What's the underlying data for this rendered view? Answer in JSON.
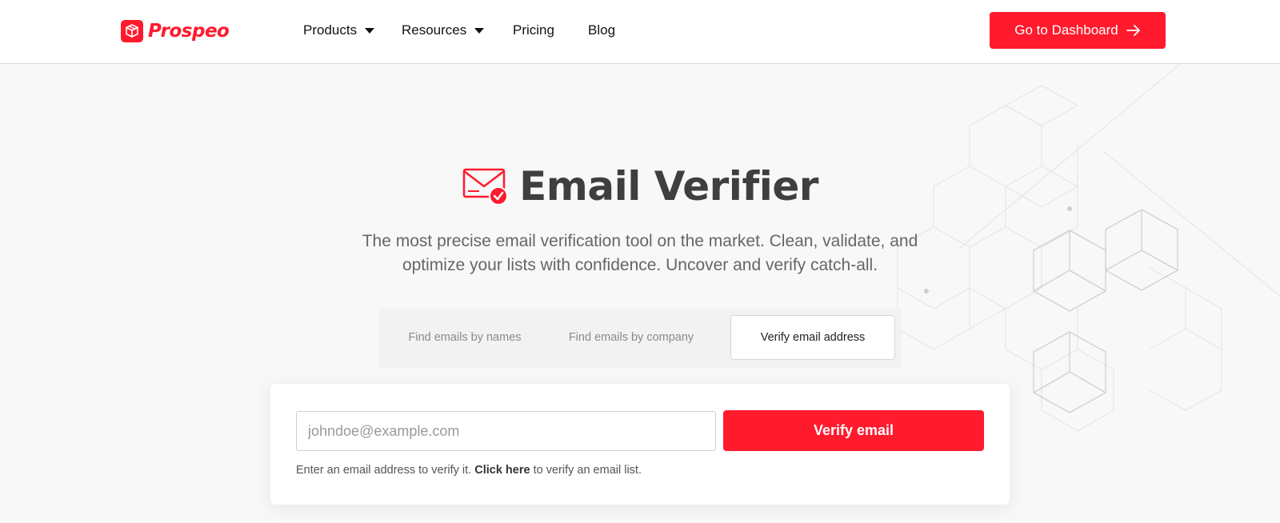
{
  "header": {
    "logo_text": "Prospeo",
    "logo_icon": "box-icon",
    "nav": [
      {
        "label": "Products",
        "has_dropdown": true
      },
      {
        "label": "Resources",
        "has_dropdown": true
      },
      {
        "label": "Pricing",
        "has_dropdown": false
      },
      {
        "label": "Blog",
        "has_dropdown": false
      }
    ],
    "cta_label": "Go to Dashboard",
    "cta_icon": "arrow-right-icon"
  },
  "hero": {
    "icon": "envelope-check-icon",
    "title": "Email Verifier",
    "subtitle_line1": "The most precise email verification tool on the market. Clean, validate, and",
    "subtitle_line2": "optimize your lists with confidence. Uncover and verify catch-all."
  },
  "tabs": [
    {
      "label": "Find emails by names",
      "active": false
    },
    {
      "label": "Find emails by company",
      "active": false
    },
    {
      "label": "Verify email address",
      "active": true
    }
  ],
  "form": {
    "email_placeholder": "johndoe@example.com",
    "email_value": "",
    "submit_label": "Verify email",
    "hint_prefix": "Enter an email address to verify it.",
    "hint_link": "Click here",
    "hint_suffix": "to verify an email list."
  },
  "colors": {
    "brand": "#ff1a2d",
    "title": "#3f3f3f",
    "background": "#f8f8f8"
  }
}
